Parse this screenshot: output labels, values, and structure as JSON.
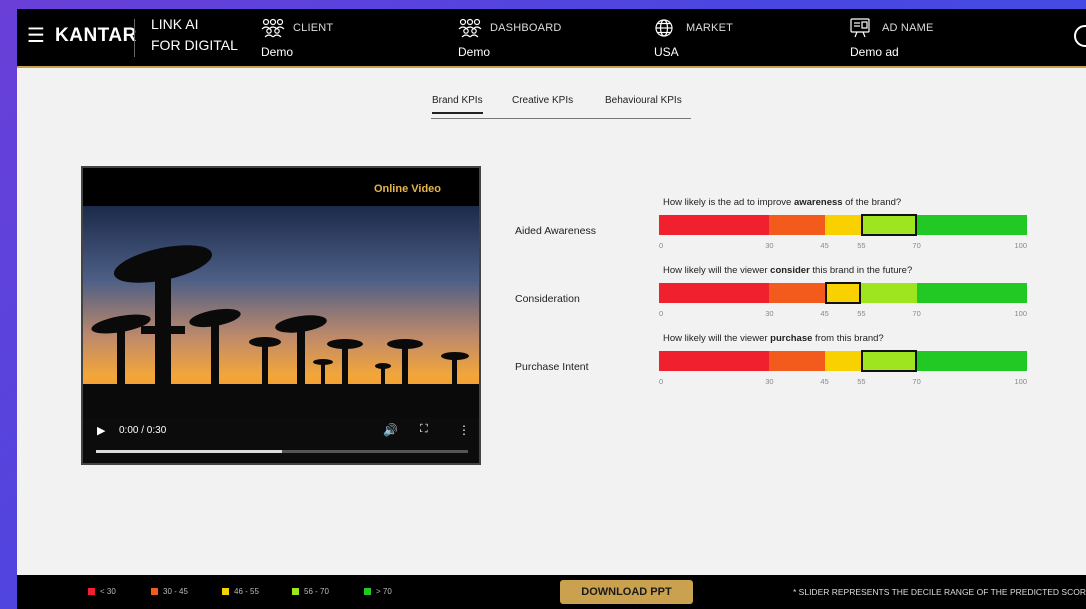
{
  "header": {
    "brand": "KANTAR",
    "product_line1": "LINK AI",
    "product_line2": "FOR DIGITAL",
    "items": [
      {
        "label": "CLIENT",
        "value": "Demo",
        "icon": "users-icon"
      },
      {
        "label": "DASHBOARD",
        "value": "Demo",
        "icon": "users-icon"
      },
      {
        "label": "MARKET",
        "value": "USA",
        "icon": "globe-icon"
      },
      {
        "label": "AD NAME",
        "value": "Demo ad",
        "icon": "ad-icon"
      }
    ]
  },
  "tabs": [
    {
      "label": "Brand KPIs",
      "active": true
    },
    {
      "label": "Creative KPIs",
      "active": false
    },
    {
      "label": "Behavioural KPIs",
      "active": false
    }
  ],
  "video": {
    "tag": "Online Video",
    "time": "0:00 / 0:30",
    "progress": 0.5
  },
  "kpis": [
    {
      "name": "Aided Awareness",
      "q_pre": "How likely is the ad to improve ",
      "q_bold": "awareness",
      "q_post": " of the brand?",
      "range": [
        55,
        70
      ]
    },
    {
      "name": "Consideration",
      "q_pre": "How likely will the viewer ",
      "q_bold": "consider",
      "q_post": " this brand in the future?",
      "range": [
        45,
        55
      ]
    },
    {
      "name": "Purchase Intent",
      "q_pre": "How likely will the viewer ",
      "q_bold": "purchase",
      "q_post": " from this brand?",
      "range": [
        55,
        70
      ]
    }
  ],
  "scale": {
    "ticks": [
      "0",
      "30",
      "45",
      "55",
      "70",
      "100"
    ],
    "segments": [
      {
        "from": 0,
        "to": 30,
        "color": "#f0202e"
      },
      {
        "from": 30,
        "to": 45,
        "color": "#f25b1c"
      },
      {
        "from": 45,
        "to": 55,
        "color": "#f9d000"
      },
      {
        "from": 55,
        "to": 70,
        "color": "#9ee51f"
      },
      {
        "from": 70,
        "to": 100,
        "color": "#22c924"
      }
    ]
  },
  "footer": {
    "legend": [
      {
        "label": "< 30",
        "color": "#f0202e"
      },
      {
        "label": "30 - 45",
        "color": "#f25b1c"
      },
      {
        "label": "46 - 55",
        "color": "#f9d000"
      },
      {
        "label": "56 - 70",
        "color": "#9ee51f"
      },
      {
        "label": "> 70",
        "color": "#22c924"
      }
    ],
    "download_label": "DOWNLOAD PPT",
    "note": "* SLIDER REPRESENTS THE DECILE RANGE OF THE PREDICTED SCORE"
  }
}
